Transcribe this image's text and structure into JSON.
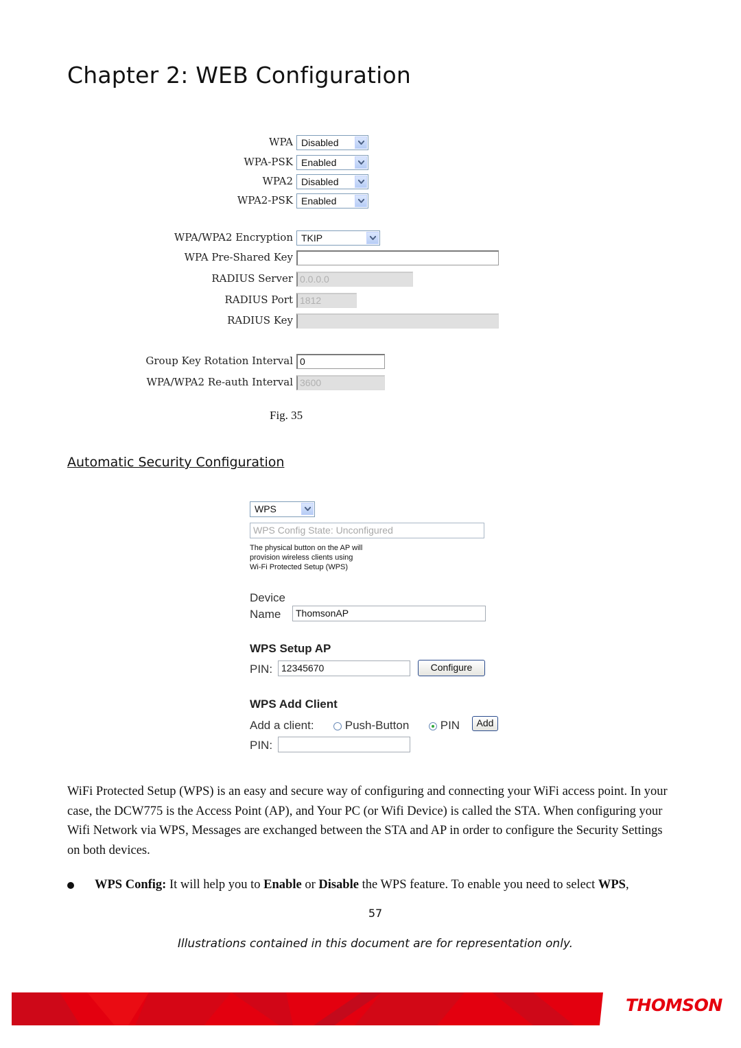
{
  "header": {
    "chapter_title": "Chapter 2: WEB Configuration"
  },
  "wpa_form": {
    "mode_rows": [
      {
        "label": "WPA",
        "value": "Disabled"
      },
      {
        "label": "WPA-PSK",
        "value": "Enabled"
      },
      {
        "label": "WPA2",
        "value": "Disabled"
      },
      {
        "label": "WPA2-PSK",
        "value": "Enabled"
      }
    ],
    "encryption": {
      "label": "WPA/WPA2 Encryption",
      "value": "TKIP"
    },
    "psk": {
      "label": "WPA Pre-Shared Key",
      "value": ""
    },
    "radius_server": {
      "label": "RADIUS Server",
      "value": "0.0.0.0"
    },
    "radius_port": {
      "label": "RADIUS Port",
      "value": "1812"
    },
    "radius_key": {
      "label": "RADIUS Key",
      "value": ""
    },
    "group_key_interval": {
      "label": "Group Key Rotation Interval",
      "value": "0"
    },
    "reauth_interval": {
      "label": "WPA/WPA2 Re-auth Interval",
      "value": "3600"
    }
  },
  "fig_caption": "Fig. 35",
  "section_heading": "Automatic Security Configuration",
  "wps_form": {
    "wps_select": "WPS",
    "config_state": "WPS Config State: Unconfigured",
    "note_lines": [
      "The physical button on the AP will",
      "provision wireless clients using",
      "Wi-Fi Protected Setup (WPS)"
    ],
    "device_label_1": "Device",
    "device_label_2": "Name",
    "device_name": "ThomsonAP",
    "setup_ap_heading": "WPS Setup AP",
    "pin_label": "PIN:",
    "ap_pin": "12345670",
    "configure_button": "Configure",
    "add_client_heading": "WPS Add Client",
    "add_client_label": "Add a client:",
    "radio_push_button": "Push-Button",
    "radio_pin": "PIN",
    "selected_method": "PIN",
    "add_button": "Add",
    "client_pin_label": "PIN:",
    "client_pin": ""
  },
  "body": {
    "paragraph": "WiFi Protected Setup (WPS) is an easy and secure way of configuring and connecting your WiFi access point. In your case, the DCW775 is the Access Point (AP), and Your PC (or Wifi Device) is called the STA.    When configuring your Wifi Network via WPS, Messages are exchanged between the STA and AP in order to configure the Security Settings on both devices.",
    "bullet": {
      "term": "WPS Config:",
      "t1": " It will help you to ",
      "b1": "Enable",
      "t2": " or ",
      "b2": "Disable",
      "t3": " the WPS feature. To enable you need to select ",
      "b3": "WPS",
      "t4": ","
    }
  },
  "footer": {
    "page_number": "57",
    "disclaimer": "Illustrations contained in this document are for representation only.",
    "brand": "THOMSON",
    "brand_color": "#e5000e"
  }
}
